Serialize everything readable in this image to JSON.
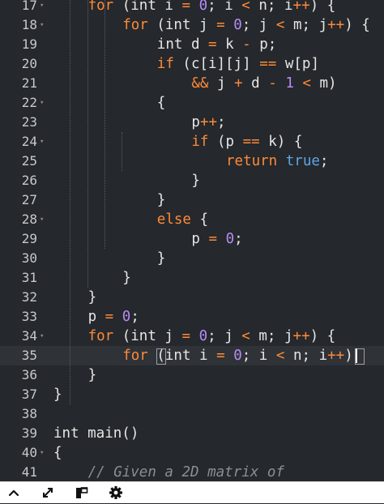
{
  "editor": {
    "lines": [
      {
        "number": "17",
        "fold": true,
        "indent": 2,
        "tokens": [
          {
            "t": "kw",
            "v": "for"
          },
          {
            "t": "txt",
            "v": " (int i "
          },
          {
            "t": "op",
            "v": "="
          },
          {
            "t": "txt",
            "v": " "
          },
          {
            "t": "num",
            "v": "0"
          },
          {
            "t": "txt",
            "v": "; i "
          },
          {
            "t": "op",
            "v": "<"
          },
          {
            "t": "txt",
            "v": " n; i"
          },
          {
            "t": "op",
            "v": "++"
          },
          {
            "t": "txt",
            "v": ") {"
          }
        ]
      },
      {
        "number": "18",
        "fold": true,
        "indent": 4,
        "tokens": [
          {
            "t": "kw",
            "v": "for"
          },
          {
            "t": "txt",
            "v": " (int j "
          },
          {
            "t": "op",
            "v": "="
          },
          {
            "t": "txt",
            "v": " "
          },
          {
            "t": "num",
            "v": "0"
          },
          {
            "t": "txt",
            "v": "; j "
          },
          {
            "t": "op",
            "v": "<"
          },
          {
            "t": "txt",
            "v": " m; j"
          },
          {
            "t": "op",
            "v": "++"
          },
          {
            "t": "txt",
            "v": ") {"
          }
        ]
      },
      {
        "number": "19",
        "fold": false,
        "indent": 6,
        "tokens": [
          {
            "t": "txt",
            "v": "int d "
          },
          {
            "t": "op",
            "v": "="
          },
          {
            "t": "txt",
            "v": " k "
          },
          {
            "t": "op",
            "v": "-"
          },
          {
            "t": "txt",
            "v": " p;"
          }
        ]
      },
      {
        "number": "20",
        "fold": false,
        "indent": 6,
        "tokens": [
          {
            "t": "kw",
            "v": "if"
          },
          {
            "t": "txt",
            "v": " (c[i][j] "
          },
          {
            "t": "op",
            "v": "=="
          },
          {
            "t": "txt",
            "v": " w[p]"
          }
        ]
      },
      {
        "number": "21",
        "fold": false,
        "indent": 8,
        "tokens": [
          {
            "t": "op",
            "v": "&&"
          },
          {
            "t": "txt",
            "v": " j "
          },
          {
            "t": "op",
            "v": "+"
          },
          {
            "t": "txt",
            "v": " d "
          },
          {
            "t": "op",
            "v": "-"
          },
          {
            "t": "txt",
            "v": " "
          },
          {
            "t": "num",
            "v": "1"
          },
          {
            "t": "txt",
            "v": " "
          },
          {
            "t": "op",
            "v": "<"
          },
          {
            "t": "txt",
            "v": " m)"
          }
        ]
      },
      {
        "number": "22",
        "fold": true,
        "indent": 6,
        "tokens": [
          {
            "t": "txt",
            "v": "{"
          }
        ]
      },
      {
        "number": "23",
        "fold": false,
        "indent": 8,
        "tokens": [
          {
            "t": "txt",
            "v": "p"
          },
          {
            "t": "op",
            "v": "++"
          },
          {
            "t": "txt",
            "v": ";"
          }
        ]
      },
      {
        "number": "24",
        "fold": true,
        "indent": 8,
        "tokens": [
          {
            "t": "kw",
            "v": "if"
          },
          {
            "t": "txt",
            "v": " (p "
          },
          {
            "t": "op",
            "v": "=="
          },
          {
            "t": "txt",
            "v": " k) {"
          }
        ]
      },
      {
        "number": "25",
        "fold": false,
        "indent": 10,
        "tokens": [
          {
            "t": "kw",
            "v": "return"
          },
          {
            "t": "txt",
            "v": " "
          },
          {
            "t": "bool",
            "v": "true"
          },
          {
            "t": "txt",
            "v": ";"
          }
        ]
      },
      {
        "number": "26",
        "fold": false,
        "indent": 8,
        "tokens": [
          {
            "t": "txt",
            "v": "}"
          }
        ]
      },
      {
        "number": "27",
        "fold": false,
        "indent": 6,
        "tokens": [
          {
            "t": "txt",
            "v": "}"
          }
        ]
      },
      {
        "number": "28",
        "fold": true,
        "indent": 6,
        "tokens": [
          {
            "t": "kw",
            "v": "else"
          },
          {
            "t": "txt",
            "v": " {"
          }
        ]
      },
      {
        "number": "29",
        "fold": false,
        "indent": 8,
        "tokens": [
          {
            "t": "txt",
            "v": "p "
          },
          {
            "t": "op",
            "v": "="
          },
          {
            "t": "txt",
            "v": " "
          },
          {
            "t": "num",
            "v": "0"
          },
          {
            "t": "txt",
            "v": ";"
          }
        ]
      },
      {
        "number": "30",
        "fold": false,
        "indent": 6,
        "tokens": [
          {
            "t": "txt",
            "v": "}"
          }
        ]
      },
      {
        "number": "31",
        "fold": false,
        "indent": 4,
        "tokens": [
          {
            "t": "txt",
            "v": "}"
          }
        ]
      },
      {
        "number": "32",
        "fold": false,
        "indent": 2,
        "tokens": [
          {
            "t": "txt",
            "v": "}"
          }
        ]
      },
      {
        "number": "33",
        "fold": false,
        "indent": 2,
        "tokens": [
          {
            "t": "txt",
            "v": "p "
          },
          {
            "t": "op",
            "v": "="
          },
          {
            "t": "txt",
            "v": " "
          },
          {
            "t": "num",
            "v": "0"
          },
          {
            "t": "txt",
            "v": ";"
          }
        ]
      },
      {
        "number": "34",
        "fold": true,
        "indent": 2,
        "tokens": [
          {
            "t": "kw",
            "v": "for"
          },
          {
            "t": "txt",
            "v": " (int j "
          },
          {
            "t": "op",
            "v": "="
          },
          {
            "t": "txt",
            "v": " "
          },
          {
            "t": "num",
            "v": "0"
          },
          {
            "t": "txt",
            "v": "; j "
          },
          {
            "t": "op",
            "v": "<"
          },
          {
            "t": "txt",
            "v": " m; j"
          },
          {
            "t": "op",
            "v": "++"
          },
          {
            "t": "txt",
            "v": ") {"
          }
        ]
      },
      {
        "number": "35",
        "fold": false,
        "indent": 4,
        "active": true,
        "tokens": [
          {
            "t": "kw",
            "v": "for"
          },
          {
            "t": "txt",
            "v": " ("
          },
          {
            "t": "txt",
            "v": "int i "
          },
          {
            "t": "op",
            "v": "="
          },
          {
            "t": "txt",
            "v": " "
          },
          {
            "t": "num",
            "v": "0"
          },
          {
            "t": "txt",
            "v": "; i "
          },
          {
            "t": "op",
            "v": "<"
          },
          {
            "t": "txt",
            "v": " n; i"
          },
          {
            "t": "op",
            "v": "++"
          },
          {
            "t": "txt",
            "v": ")"
          }
        ]
      },
      {
        "number": "36",
        "fold": false,
        "indent": 2,
        "tokens": [
          {
            "t": "txt",
            "v": "}"
          }
        ]
      },
      {
        "number": "37",
        "fold": false,
        "indent": 0,
        "tokens": [
          {
            "t": "txt",
            "v": "}"
          }
        ]
      },
      {
        "number": "38",
        "fold": false,
        "indent": 0,
        "tokens": []
      },
      {
        "number": "39",
        "fold": false,
        "indent": 0,
        "tokens": [
          {
            "t": "txt",
            "v": "int main()"
          }
        ]
      },
      {
        "number": "40",
        "fold": true,
        "indent": 0,
        "tokens": [
          {
            "t": "txt",
            "v": "{"
          }
        ]
      },
      {
        "number": "41",
        "fold": false,
        "indent": 2,
        "tokens": [
          {
            "t": "cmt",
            "v": "// Given a 2D matrix of"
          }
        ]
      }
    ]
  },
  "toolbar": {
    "buttons": [
      {
        "name": "collapse-button",
        "icon": "chevron-up-icon"
      },
      {
        "name": "fullscreen-button",
        "icon": "expand-arrows-icon"
      },
      {
        "name": "layout-button",
        "icon": "panel-layout-icon"
      },
      {
        "name": "settings-button",
        "icon": "gear-icon"
      }
    ]
  }
}
